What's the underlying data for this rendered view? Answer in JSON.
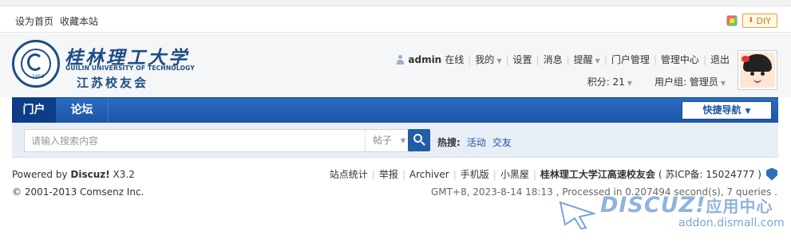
{
  "topbar": {
    "set_home": "设为首页",
    "bookmark": "收藏本站",
    "diy": "DIY"
  },
  "logo": {
    "cn": "桂林理工大学",
    "en": "GUILIN UNIVERSITY OF TECHNOLOGY",
    "sub": "江苏校友会",
    "seal_year": "1956"
  },
  "usernav": {
    "username": "admin",
    "online": "在线",
    "mine": "我的",
    "settings": "设置",
    "messages": "消息",
    "reminders": "提醒",
    "portal_admin": "门户管理",
    "admin_center": "管理中心",
    "logout": "退出",
    "credits": "积分: 21",
    "usergroup": "用户组: 管理员"
  },
  "nav": {
    "home": "门户",
    "forum": "论坛",
    "quick": "快捷导航"
  },
  "search": {
    "placeholder": "请输入搜索内容",
    "type": "帖子",
    "hot_label": "热搜:",
    "hot_keywords": [
      "活动",
      "交友"
    ]
  },
  "footer": {
    "powered_prefix": "Powered by ",
    "powered_brand": "Discuz!",
    "powered_version": " X3.2",
    "copyright": "© 2001-2013 Comsenz Inc.",
    "links": [
      "站点统计",
      "举报",
      "Archiver",
      "手机版",
      "小黑屋"
    ],
    "school": "桂林理工大学江高速校友会",
    "icp": "( 苏ICP备: 15024777 )",
    "time": "GMT+8, 2023-8-14 18:13 , Processed in 0.207494 second(s), 7 queries ."
  },
  "watermark": {
    "brand": "DISCUZ!",
    "brand_cn": "应用中心",
    "url": "addon.dismall.com"
  }
}
